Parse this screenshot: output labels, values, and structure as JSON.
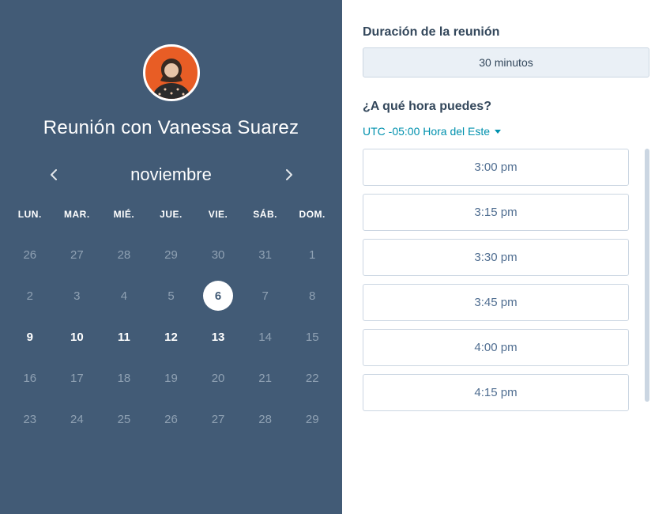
{
  "meeting": {
    "title": "Reunión con Vanessa Suarez",
    "avatar_bg": "#e85d25"
  },
  "calendar": {
    "month_label": "noviembre",
    "dow": [
      "LUN.",
      "MAR.",
      "MIÉ.",
      "JUE.",
      "VIE.",
      "SÁB.",
      "DOM."
    ],
    "weeks": [
      [
        {
          "n": "26",
          "state": "dim"
        },
        {
          "n": "27",
          "state": "dim"
        },
        {
          "n": "28",
          "state": "dim"
        },
        {
          "n": "29",
          "state": "dim"
        },
        {
          "n": "30",
          "state": "dim"
        },
        {
          "n": "31",
          "state": "dim"
        },
        {
          "n": "1",
          "state": "dim"
        }
      ],
      [
        {
          "n": "2",
          "state": "dim"
        },
        {
          "n": "3",
          "state": "dim"
        },
        {
          "n": "4",
          "state": "dim"
        },
        {
          "n": "5",
          "state": "dim"
        },
        {
          "n": "6",
          "state": "selected"
        },
        {
          "n": "7",
          "state": "dim"
        },
        {
          "n": "8",
          "state": "dim"
        }
      ],
      [
        {
          "n": "9",
          "state": "avail"
        },
        {
          "n": "10",
          "state": "avail"
        },
        {
          "n": "11",
          "state": "avail"
        },
        {
          "n": "12",
          "state": "avail"
        },
        {
          "n": "13",
          "state": "avail"
        },
        {
          "n": "14",
          "state": "dim"
        },
        {
          "n": "15",
          "state": "dim"
        }
      ],
      [
        {
          "n": "16",
          "state": "dim"
        },
        {
          "n": "17",
          "state": "dim"
        },
        {
          "n": "18",
          "state": "dim"
        },
        {
          "n": "19",
          "state": "dim"
        },
        {
          "n": "20",
          "state": "dim"
        },
        {
          "n": "21",
          "state": "dim"
        },
        {
          "n": "22",
          "state": "dim"
        }
      ],
      [
        {
          "n": "23",
          "state": "dim"
        },
        {
          "n": "24",
          "state": "dim"
        },
        {
          "n": "25",
          "state": "dim"
        },
        {
          "n": "26",
          "state": "dim"
        },
        {
          "n": "27",
          "state": "dim"
        },
        {
          "n": "28",
          "state": "dim"
        },
        {
          "n": "29",
          "state": "dim"
        }
      ]
    ]
  },
  "right": {
    "duration_heading": "Duración de la reunión",
    "duration_value": "30 minutos",
    "time_heading": "¿A qué hora puedes?",
    "timezone_label": "UTC -05:00 Hora del Este",
    "slots": [
      "3:00 pm",
      "3:15 pm",
      "3:30 pm",
      "3:45 pm",
      "4:00 pm",
      "4:15 pm"
    ]
  }
}
